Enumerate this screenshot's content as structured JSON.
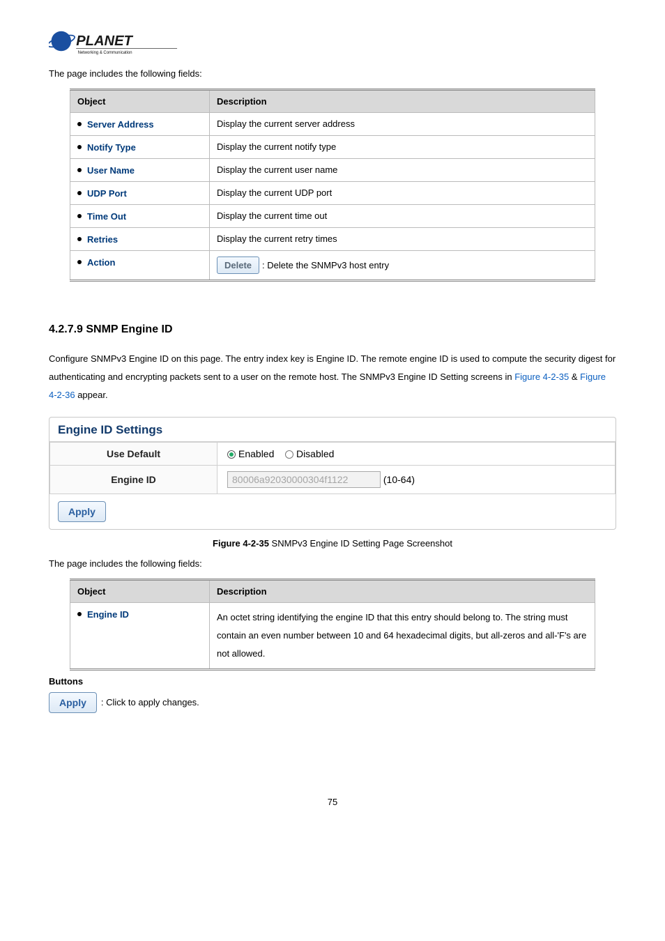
{
  "logo": {
    "brand": "PLANET",
    "tagline": "Networking & Communication"
  },
  "intro1": "The page includes the following fields:",
  "table1": {
    "head_object": "Object",
    "head_description": "Description",
    "rows": [
      {
        "obj": "Server Address",
        "desc": "Display the current server address"
      },
      {
        "obj": "Notify Type",
        "desc": "Display the current notify type"
      },
      {
        "obj": "User Name",
        "desc": "Display the current user name"
      },
      {
        "obj": "UDP Port",
        "desc": "Display the current UDP port"
      },
      {
        "obj": "Time Out",
        "desc": "Display the current time out"
      },
      {
        "obj": "Retries",
        "desc": "Display the current retry times"
      },
      {
        "obj": "Action",
        "desc_btn": "Delete",
        "desc_after": ": Delete the SNMPv3 host entry"
      }
    ]
  },
  "section_heading": "4.2.7.9 SNMP Engine ID",
  "body_paragraph_pre": "Configure SNMPv3 Engine ID on this page. The entry index key is Engine ID. The remote engine ID is used to compute the security digest for authenticating and encrypting packets sent to a user on the remote host. The SNMPv3 Engine ID Setting screens in ",
  "fig_link_1": "Figure 4-2-35",
  "amp": " & ",
  "fig_link_2": "Figure 4-2-36",
  "body_paragraph_post": " appear.",
  "engine_panel": {
    "header": "Engine ID Settings",
    "row1_label": "Use Default",
    "row1_opt_enabled": "Enabled",
    "row1_opt_disabled": "Disabled",
    "row2_label": "Engine ID",
    "row2_value": "80006a92030000304f1122",
    "row2_hint": "(10-64)",
    "apply": "Apply"
  },
  "fig_caption_bold": "Figure 4-2-35",
  "fig_caption_rest": " SNMPv3 Engine ID Setting Page Screenshot",
  "intro2": "The page includes the following fields:",
  "table2": {
    "head_object": "Object",
    "head_description": "Description",
    "row_obj": "Engine ID",
    "row_desc": "An octet string identifying the engine ID that this entry should belong to. The string must contain an even number between 10 and 64 hexadecimal digits, but all-zeros and all-'F's are not allowed."
  },
  "buttons_heading": "Buttons",
  "apply_btn_label": "Apply",
  "apply_btn_desc": ": Click to apply changes.",
  "page_number": "75"
}
